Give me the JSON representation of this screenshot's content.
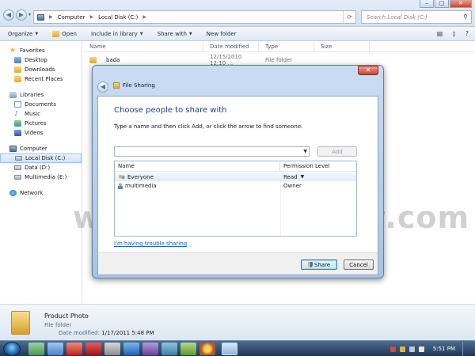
{
  "window": {
    "minimize": "–",
    "maximize": "□",
    "close": "✕"
  },
  "nav": {
    "back": "◀",
    "forward": "▶",
    "recent": "▾"
  },
  "address": {
    "crumbs": [
      "Computer",
      "Local Disk (C:)"
    ],
    "refresh": "⟳"
  },
  "search": {
    "placeholder": "Search Local Disk (C:)",
    "icon": "⚲"
  },
  "toolbar": {
    "organize": "Organize",
    "open": "Open",
    "include_in_library": "Include in library",
    "share_with": "Share with",
    "new_folder": "New folder"
  },
  "sidebar": {
    "favorites": "Favorites",
    "favorites_items": [
      "Desktop",
      "Downloads",
      "Recent Places"
    ],
    "libraries": "Libraries",
    "libraries_items": [
      "Documents",
      "Music",
      "Pictures",
      "Videos"
    ],
    "computer": "Computer",
    "computer_items": [
      "Local Disk (C:)",
      "Data (D:)",
      "Multimedia (E:)"
    ],
    "network": "Network"
  },
  "filelist": {
    "columns": [
      "Name",
      "Date modified",
      "Type",
      "Size"
    ],
    "rows": [
      {
        "name": "bada",
        "date": "12/15/2010 12:10 ...",
        "type": "File folder",
        "size": ""
      }
    ]
  },
  "details": {
    "name": "Product Photo",
    "type": "File folder",
    "modified_label": "Date modified:",
    "modified_value": "1/17/2011 5:48 PM"
  },
  "taskbar": {
    "clock": "5:51 PM"
  },
  "watermark": "www.JagatReview.com",
  "dialog": {
    "back": "◀",
    "title": "File Sharing",
    "close": "✕",
    "heading": "Choose people to share with",
    "instructions": "Type a name and then click Add, or click the arrow to find someone.",
    "combo_value": "",
    "add_label": "Add",
    "table": {
      "col_name": "Name",
      "col_permission": "Permission Level",
      "rows": [
        {
          "name": "Everyone",
          "permission": "Read"
        },
        {
          "name": "multimedia",
          "permission": "Owner"
        }
      ]
    },
    "trouble_link": "I'm having trouble sharing",
    "share_label": "Share",
    "cancel_label": "Cancel"
  },
  "colors": {
    "accent": "#1c3f94",
    "link": "#1f5bbf",
    "taskbar": "#1f3656"
  }
}
